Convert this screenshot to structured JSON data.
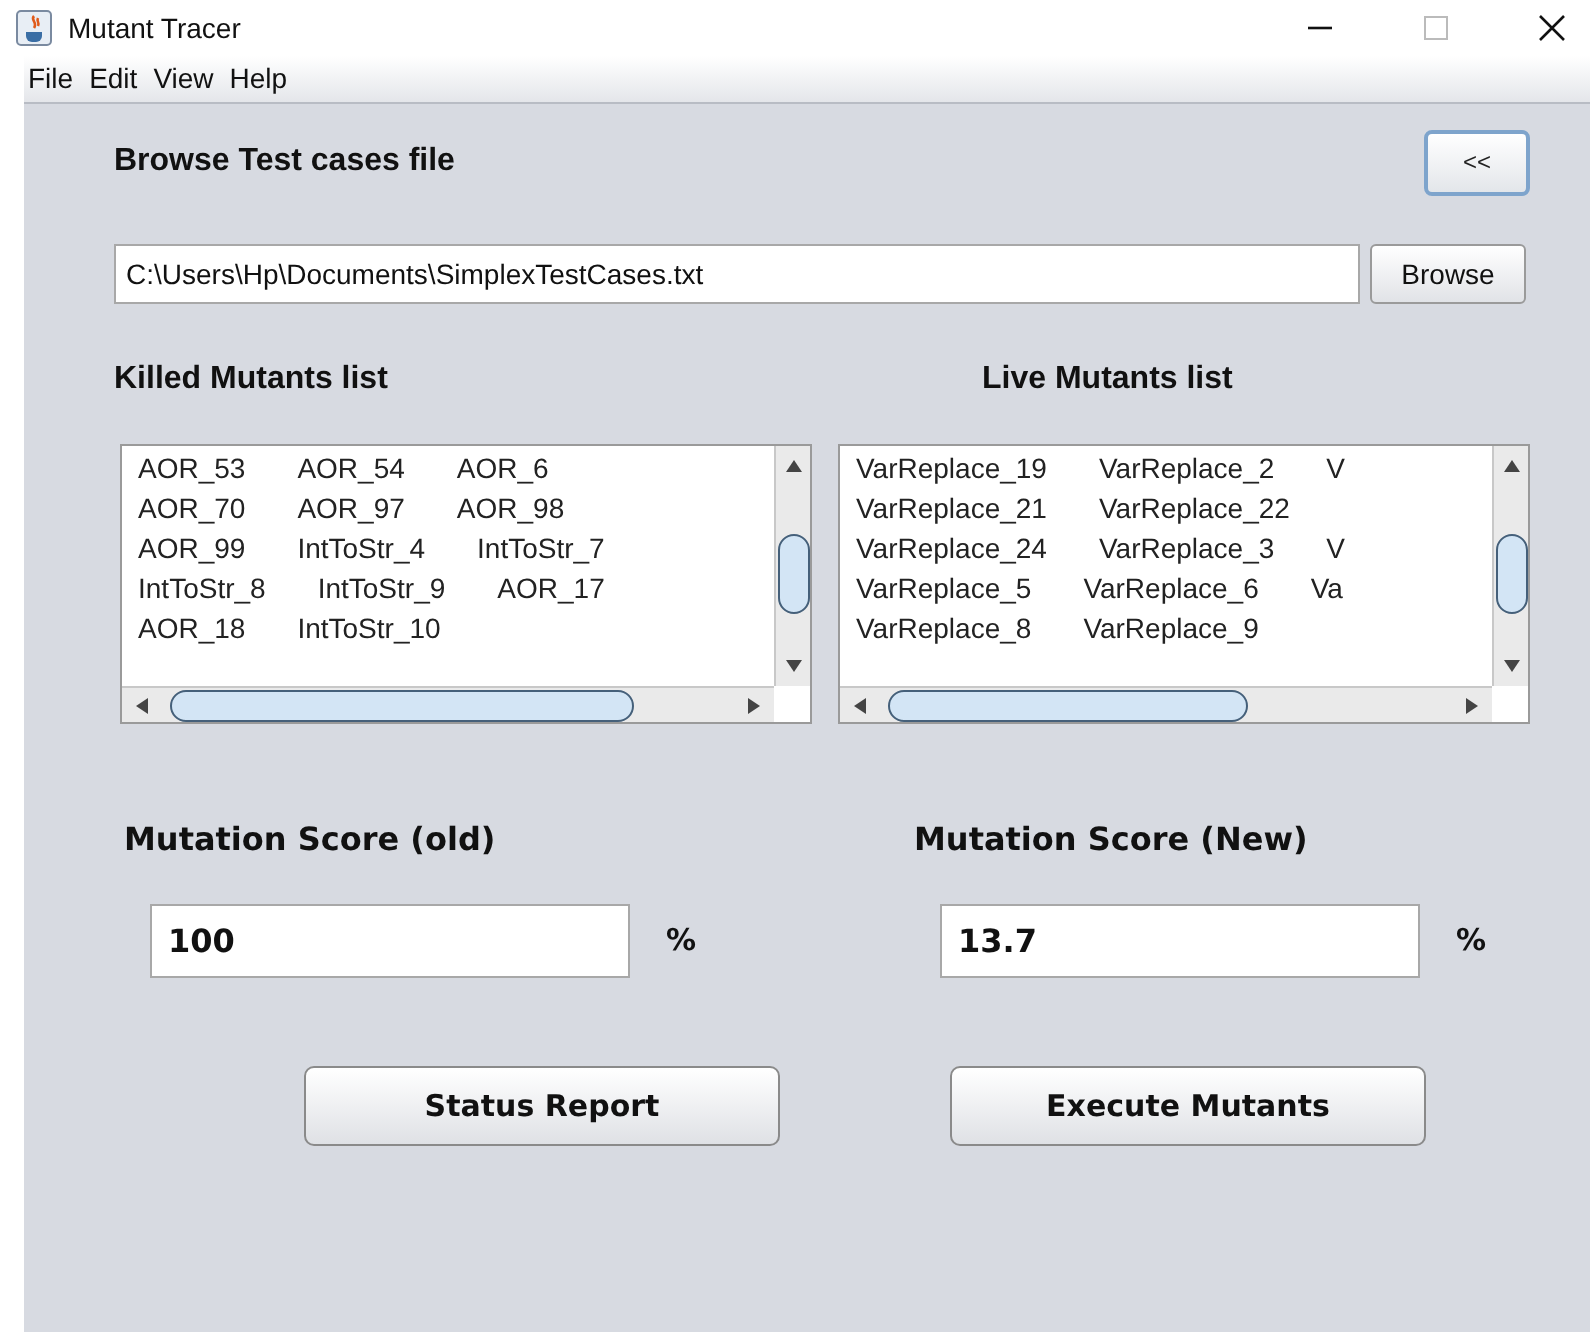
{
  "window": {
    "title": "Mutant Tracer"
  },
  "menu": [
    "File",
    "Edit",
    "View",
    "Help"
  ],
  "browse": {
    "label": "Browse Test cases file",
    "back_button": "<<",
    "path": "C:\\Users\\Hp\\Documents\\SimplexTestCases.txt",
    "browse_button": "Browse"
  },
  "lists": [
    {
      "title": "Killed Mutants list",
      "rows": [
        [
          "AOR_53",
          "AOR_54",
          "AOR_6"
        ],
        [
          "AOR_70",
          "AOR_97",
          "AOR_98"
        ],
        [
          "AOR_99",
          "IntToStr_4",
          "IntToStr_7"
        ],
        [
          "IntToStr_8",
          "IntToStr_9",
          "AOR_17"
        ],
        [
          "AOR_18",
          "IntToStr_10"
        ]
      ]
    },
    {
      "title": "Live Mutants list",
      "rows": [
        [
          "VarReplace_19",
          "VarReplace_2",
          "V"
        ],
        [
          "VarReplace_21",
          "VarReplace_22"
        ],
        [
          "VarReplace_24",
          "VarReplace_3",
          "V"
        ],
        [
          "VarReplace_5",
          "VarReplace_6",
          "Va"
        ],
        [
          "VarReplace_8",
          "VarReplace_9"
        ]
      ]
    }
  ],
  "scores": [
    {
      "label": "Mutation Score (old)",
      "value": "100",
      "unit": "%"
    },
    {
      "label": "Mutation Score (New)",
      "value": "13.7",
      "unit": "%"
    }
  ],
  "buttons": [
    "Status Report",
    "Execute Mutants"
  ]
}
